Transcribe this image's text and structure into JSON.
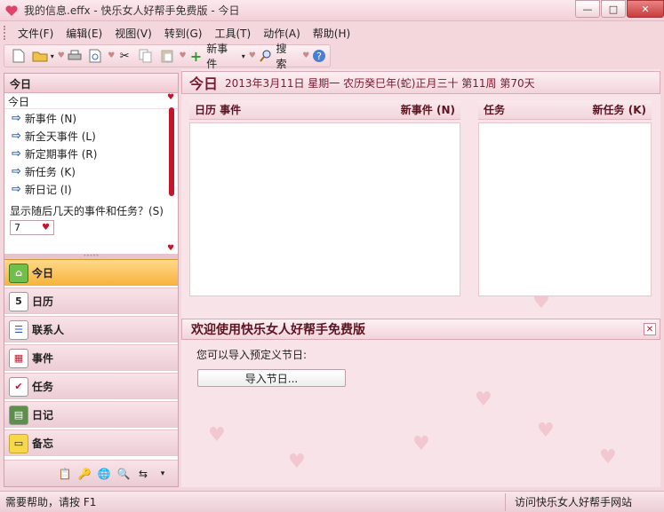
{
  "window": {
    "title": "我的信息.effx - 快乐女人好帮手免费版 - 今日",
    "minimize": "—",
    "maximize": "□",
    "close": "✕"
  },
  "menu": [
    "文件(F)",
    "编辑(E)",
    "视图(V)",
    "转到(G)",
    "工具(T)",
    "动作(A)",
    "帮助(H)"
  ],
  "toolbar": {
    "new_event_label": "新事件",
    "search_label": "搜索"
  },
  "left_panel": {
    "header": "今日",
    "today_label": "今日",
    "links": [
      "新事件 (N)",
      "新全天事件 (L)",
      "新定期事件 (R)",
      "新任务 (K)",
      "新日记 (I)"
    ],
    "question": "显示随后几天的事件和任务？(S)",
    "days_value": "7"
  },
  "nav": [
    {
      "label": "今日",
      "icon": "home-icon",
      "active": true
    },
    {
      "label": "日历",
      "icon": "calendar-icon",
      "glyph": "5"
    },
    {
      "label": "联系人",
      "icon": "contacts-icon",
      "glyph": "☰"
    },
    {
      "label": "事件",
      "icon": "events-icon",
      "glyph": "▦"
    },
    {
      "label": "任务",
      "icon": "tasks-icon",
      "glyph": "✔"
    },
    {
      "label": "日记",
      "icon": "diary-icon",
      "glyph": "▤"
    },
    {
      "label": "备忘",
      "icon": "notes-icon",
      "glyph": "▭"
    }
  ],
  "today_view": {
    "title": "今日",
    "date_text": "2013年3月11日 星期一 农历癸巳年(蛇)正月三十 第11周 第70天",
    "events_header": "日历 事件",
    "new_event_link": "新事件 (N)",
    "tasks_header": "任务",
    "new_task_link": "新任务 (K)"
  },
  "welcome": {
    "title": "欢迎使用快乐女人好帮手免费版",
    "text": "您可以导入预定义节日:",
    "import_button": "导入节日..."
  },
  "status": {
    "help_text": "需要帮助，请按 F1",
    "website_link": "访问快乐女人好帮手网站"
  },
  "colors": {
    "accent": "#7a1b2d",
    "active_nav": "#f7b23c",
    "background": "#f8e4e8"
  }
}
